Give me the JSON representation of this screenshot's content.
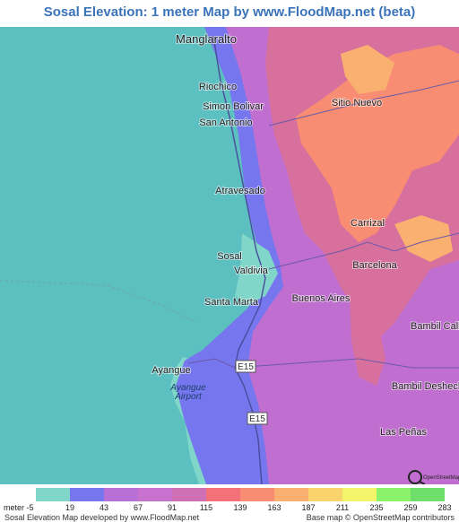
{
  "title": "Sosal Elevation: 1 meter Map by www.FloodMap.net (beta)",
  "places": [
    {
      "name": "Manglaralto",
      "size": "big"
    },
    {
      "name": "Riochico",
      "size": "normal"
    },
    {
      "name": "Simon Bolivar",
      "size": "normal"
    },
    {
      "name": "San Antonio",
      "size": "normal"
    },
    {
      "name": "Sitio Nuevo",
      "size": "normal"
    },
    {
      "name": "Atravesado",
      "size": "normal"
    },
    {
      "name": "Carrizal",
      "size": "normal"
    },
    {
      "name": "Sosal",
      "size": "normal"
    },
    {
      "name": "Valdivia",
      "size": "normal"
    },
    {
      "name": "Barcelona",
      "size": "normal"
    },
    {
      "name": "Santa Marta",
      "size": "normal"
    },
    {
      "name": "Buenos Aires",
      "size": "normal"
    },
    {
      "name": "Bambil Callao",
      "size": "normal"
    },
    {
      "name": "Ayangue",
      "size": "normal"
    },
    {
      "name": "Bambil Deshecho",
      "size": "normal"
    },
    {
      "name": "Las Peñas",
      "size": "normal"
    }
  ],
  "airport": {
    "line1": "Ayangue",
    "line2": "Airport"
  },
  "roads": [
    {
      "ref": "E15"
    },
    {
      "ref": "E15"
    }
  ],
  "osm_logo_text": "OpenStreetMap",
  "legend": {
    "unit_label": "meter",
    "values": [
      "-5",
      "19",
      "43",
      "67",
      "91",
      "115",
      "139",
      "163",
      "187",
      "211",
      "235",
      "259",
      "283"
    ],
    "colors": [
      "#7fd6c9",
      "#7676ef",
      "#b86fd6",
      "#c971cf",
      "#d070b4",
      "#f5717a",
      "#f88d74",
      "#f9b071",
      "#f9d36c",
      "#f4f46a",
      "#8df26b",
      "#6ddf6a"
    ]
  },
  "credits": {
    "left": "Sosal Elevation Map developed by www.FloodMap.net",
    "right": "Base map © OpenStreetMap contributors"
  },
  "map_colors": {
    "sea": "#5cbfc0",
    "lowland": "#7fd6c9",
    "low": "#7676ef",
    "mid": "#c06fd0",
    "high": "#d8709e",
    "peak": "#f88d74"
  }
}
